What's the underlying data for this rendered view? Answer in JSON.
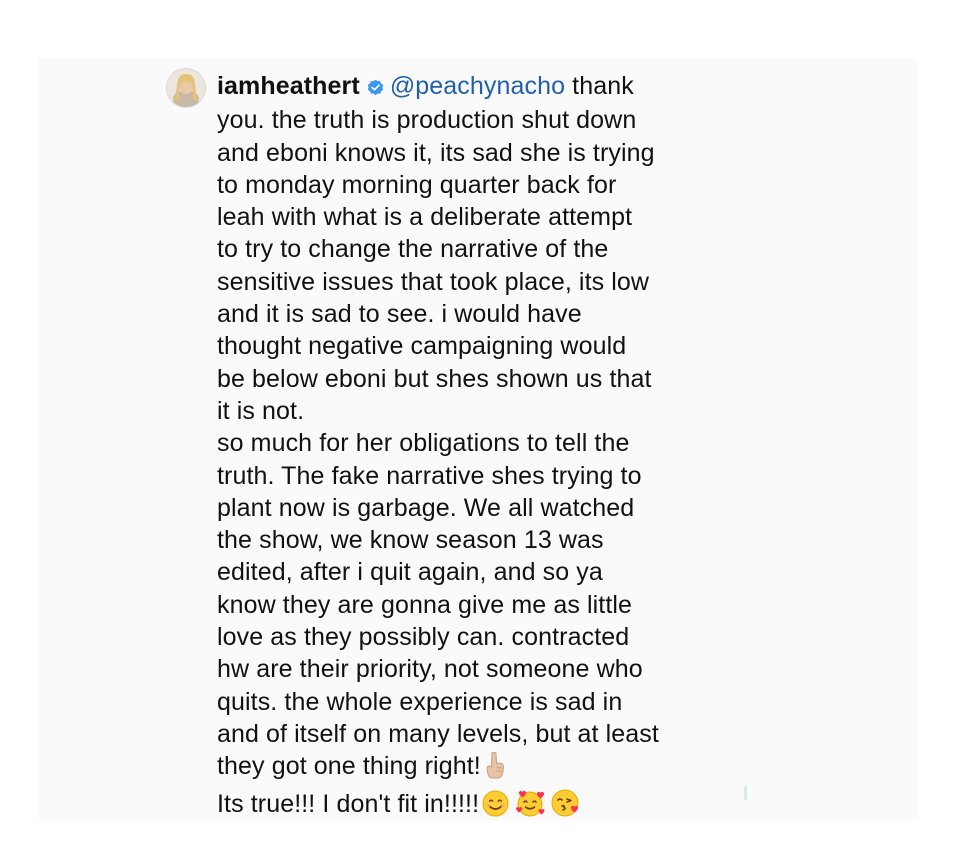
{
  "comment": {
    "username": "iamheathert",
    "verified": true,
    "mention": "@peachynacho",
    "first_line_rest": " thank",
    "lines": [
      "you. the truth is production shut down",
      "and eboni knows it, its sad she is trying",
      "to monday morning quarter back for",
      "leah with what is a deliberate attempt",
      "to try to change the narrative of the",
      "sensitive issues that took place, its low",
      "and it is sad to see. i would have",
      "thought negative campaigning would",
      "be below eboni but shes shown us that",
      "it is not.",
      "so much for her obligations to tell the",
      "truth. The fake narrative shes trying to",
      "plant now is garbage. We all watched",
      "the show, we know season 13 was",
      "edited, after i quit again, and so ya",
      "know they are gonna give me as little",
      "love as they possibly can. contracted",
      "hw are their priority, not someone who",
      "quits. the whole experience is sad in",
      "and of itself on many levels, but at least"
    ],
    "line_21": "they got one thing right!",
    "line_21_emoji": "pointing-up-hand-emoji",
    "last_line": "Its true!!! I don't fit in!!!!!",
    "last_line_emojis": [
      "smiling-face-emoji",
      "smiling-face-with-hearts-emoji",
      "face-blowing-kiss-emoji"
    ]
  },
  "colors": {
    "background": "#ffffff",
    "card": "#fafafa",
    "text": "#111111",
    "mention": "#1f5fb0",
    "verified_badge": "#3897f0"
  }
}
